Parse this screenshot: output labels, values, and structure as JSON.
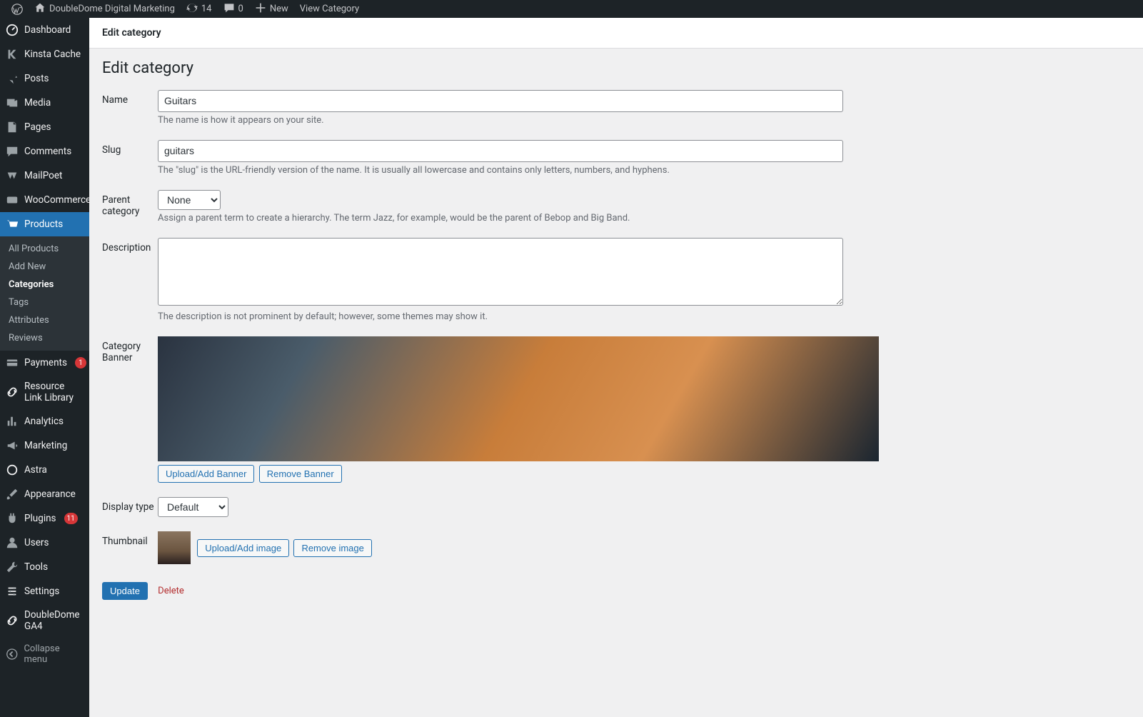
{
  "toolbar": {
    "site_name": "DoubleDome Digital Marketing",
    "updates_count": "14",
    "comments_count": "0",
    "new_label": "New",
    "view_label": "View Category"
  },
  "sidebar": {
    "items": [
      {
        "label": "Dashboard"
      },
      {
        "label": "Kinsta Cache"
      },
      {
        "label": "Posts"
      },
      {
        "label": "Media"
      },
      {
        "label": "Pages"
      },
      {
        "label": "Comments"
      },
      {
        "label": "MailPoet"
      },
      {
        "label": "WooCommerce"
      },
      {
        "label": "Products"
      },
      {
        "label": "Payments",
        "badge": "1"
      },
      {
        "label": "Resource Link Library"
      },
      {
        "label": "Analytics"
      },
      {
        "label": "Marketing"
      },
      {
        "label": "Astra"
      },
      {
        "label": "Appearance"
      },
      {
        "label": "Plugins",
        "badge": "11"
      },
      {
        "label": "Users"
      },
      {
        "label": "Tools"
      },
      {
        "label": "Settings"
      },
      {
        "label": "DoubleDome GA4"
      }
    ],
    "submenu": {
      "items": [
        {
          "label": "All Products"
        },
        {
          "label": "Add New"
        },
        {
          "label": "Categories"
        },
        {
          "label": "Tags"
        },
        {
          "label": "Attributes"
        },
        {
          "label": "Reviews"
        }
      ]
    },
    "collapse_label": "Collapse menu"
  },
  "header": {
    "breadcrumb": "Edit category",
    "title": "Edit category"
  },
  "form": {
    "name": {
      "label": "Name",
      "value": "Guitars",
      "help": "The name is how it appears on your site."
    },
    "slug": {
      "label": "Slug",
      "value": "guitars",
      "help": "The \"slug\" is the URL-friendly version of the name. It is usually all lowercase and contains only letters, numbers, and hyphens."
    },
    "parent": {
      "label": "Parent category",
      "selected": "None",
      "help": "Assign a parent term to create a hierarchy. The term Jazz, for example, would be the parent of Bebop and Big Band."
    },
    "description": {
      "label": "Description",
      "value": "",
      "help": "The description is not prominent by default; however, some themes may show it."
    },
    "banner": {
      "label": "Category Banner",
      "upload_btn": "Upload/Add Banner",
      "remove_btn": "Remove Banner"
    },
    "display": {
      "label": "Display type",
      "selected": "Default"
    },
    "thumbnail": {
      "label": "Thumbnail",
      "upload_btn": "Upload/Add image",
      "remove_btn": "Remove image"
    },
    "update_btn": "Update",
    "delete_link": "Delete"
  }
}
